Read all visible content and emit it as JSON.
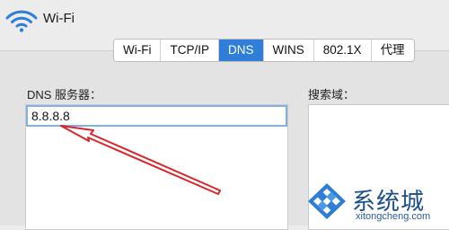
{
  "window": {
    "title": "Wi-Fi"
  },
  "tabs": [
    {
      "label": "Wi-Fi",
      "active": false
    },
    {
      "label": "TCP/IP",
      "active": false
    },
    {
      "label": "DNS",
      "active": true
    },
    {
      "label": "WINS",
      "active": false
    },
    {
      "label": "802.1X",
      "active": false
    },
    {
      "label": "代理",
      "active": false
    }
  ],
  "dns": {
    "label": "DNS 服务器：",
    "entries": [
      "8.8.8.8"
    ]
  },
  "search_domains": {
    "label": "搜索域：",
    "entries": []
  },
  "watermark": {
    "brand": "系统城",
    "url": "xitongcheng.com"
  },
  "colors": {
    "accent": "#2f7fd8",
    "annotation_arrow": "#d9262a",
    "watermark_blue": "#1a4d8c"
  }
}
